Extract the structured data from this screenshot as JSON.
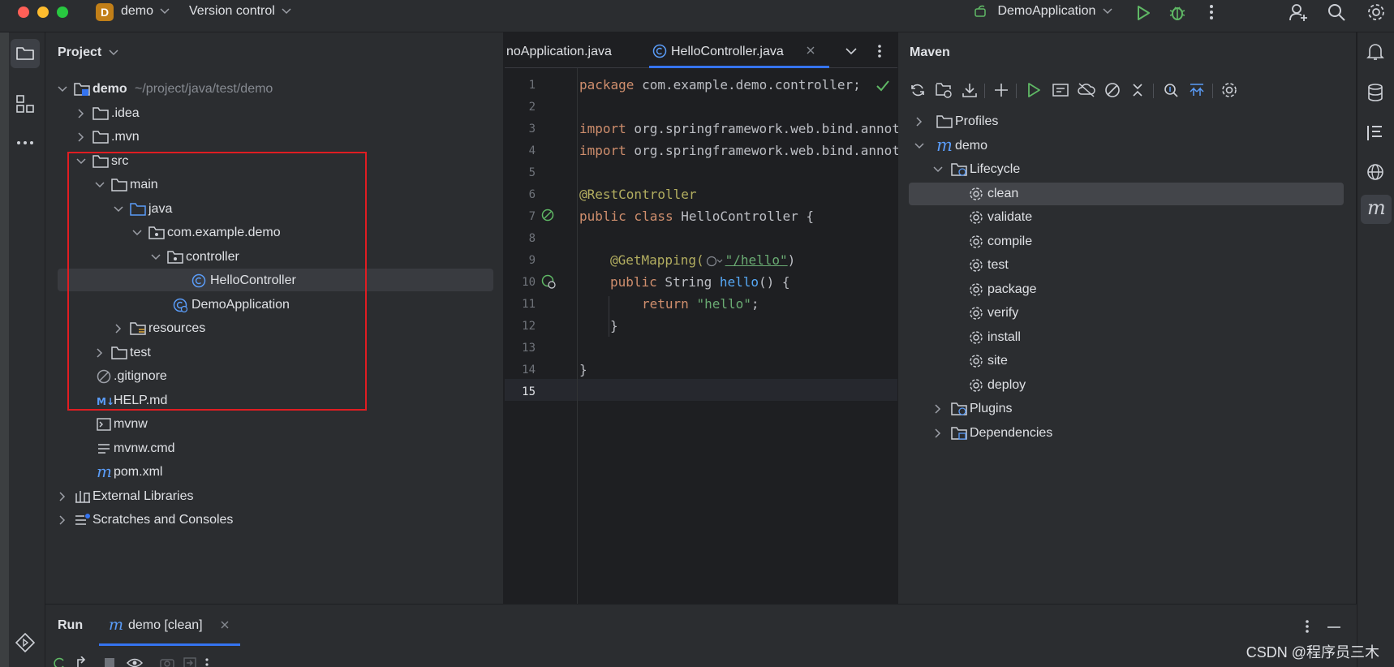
{
  "titlebar": {
    "project_badge": "D",
    "project_name": "demo",
    "vcs_label": "Version control",
    "run_config": "DemoApplication"
  },
  "project_panel": {
    "title": "Project",
    "tree": [
      {
        "label": "demo",
        "hint": "~/project/java/test/demo"
      },
      {
        "label": ".idea"
      },
      {
        "label": ".mvn"
      },
      {
        "label": "src"
      },
      {
        "label": "main"
      },
      {
        "label": "java"
      },
      {
        "label": "com.example.demo"
      },
      {
        "label": "controller"
      },
      {
        "label": "HelloController"
      },
      {
        "label": "DemoApplication"
      },
      {
        "label": "resources"
      },
      {
        "label": "test"
      },
      {
        "label": ".gitignore"
      },
      {
        "label": "HELP.md"
      },
      {
        "label": "mvnw"
      },
      {
        "label": "mvnw.cmd"
      },
      {
        "label": "pom.xml"
      },
      {
        "label": "External Libraries"
      },
      {
        "label": "Scratches and Consoles"
      }
    ]
  },
  "editor": {
    "tabs": [
      {
        "label": "noApplication.java"
      },
      {
        "label": "HelloController.java"
      }
    ],
    "line_numbers": [
      "1",
      "2",
      "3",
      "4",
      "5",
      "6",
      "7",
      "8",
      "9",
      "10",
      "11",
      "12",
      "13",
      "14",
      "15"
    ],
    "code": {
      "l1_kw": "package",
      "l1_rest": " com.example.demo.controller;",
      "l3_kw": "import",
      "l3_rest": " org.springframework.web.bind.annot",
      "l4_kw": "import",
      "l4_rest": " org.springframework.web.bind.annot",
      "l6": "@RestController",
      "l7_kw": "public class",
      "l7_rest": " HelloController {",
      "l9_ann": "@GetMapping(",
      "l9_str": "\"/hello\"",
      "l9_end": ")",
      "l10_kw": "public",
      "l10_type": " String ",
      "l10_fn": "hello",
      "l10_end": "() {",
      "l11_kw": "return",
      "l11_str": "\"hello\"",
      "l11_end": ";",
      "l12": "}",
      "l14": "}"
    }
  },
  "maven": {
    "title": "Maven",
    "tree": [
      {
        "label": "Profiles"
      },
      {
        "label": "demo"
      },
      {
        "label": "Lifecycle"
      },
      {
        "label": "clean"
      },
      {
        "label": "validate"
      },
      {
        "label": "compile"
      },
      {
        "label": "test"
      },
      {
        "label": "package"
      },
      {
        "label": "verify"
      },
      {
        "label": "install"
      },
      {
        "label": "site"
      },
      {
        "label": "deploy"
      },
      {
        "label": "Plugins"
      },
      {
        "label": "Dependencies"
      }
    ]
  },
  "run": {
    "title": "Run",
    "tab_label": "demo [clean]"
  },
  "watermark": "CSDN @程序员三木",
  "colors": {
    "accent": "#3574f0",
    "selection_box": "#e01d22",
    "run_green": "#5fb865"
  }
}
